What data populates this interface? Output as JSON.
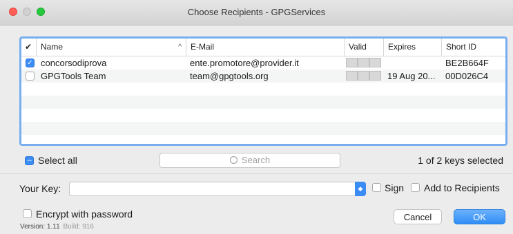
{
  "window": {
    "title": "Choose Recipients - GPGServices"
  },
  "table": {
    "columns": {
      "check": "✔",
      "name": "Name",
      "sort_indicator": "^",
      "email": "E-Mail",
      "valid": "Valid",
      "expires": "Expires",
      "short_id": "Short ID"
    },
    "rows": [
      {
        "checked": true,
        "name": "concorsodiprova",
        "email": "ente.promotore@provider.it",
        "expires": "",
        "short_id": "BE2B664F"
      },
      {
        "checked": false,
        "name": "GPGTools Team",
        "email": "team@gpgtools.org",
        "expires": "19 Aug 20...",
        "short_id": "00D026C4"
      }
    ]
  },
  "controls": {
    "select_all_label": "Select all",
    "search_placeholder": "Search",
    "selection_status": "1 of 2 keys selected",
    "your_key_label": "Your Key:",
    "your_key_value": "",
    "sign_label": "Sign",
    "add_to_recipients_label": "Add to Recipients",
    "encrypt_password_label": "Encrypt with password",
    "version_label": "Version:",
    "version_value": "1.11",
    "build_label": "Build:",
    "build_value": "916",
    "cancel_label": "Cancel",
    "ok_label": "OK"
  },
  "colors": {
    "accent": "#3b8cf5",
    "focus_ring": "#78aef0"
  }
}
